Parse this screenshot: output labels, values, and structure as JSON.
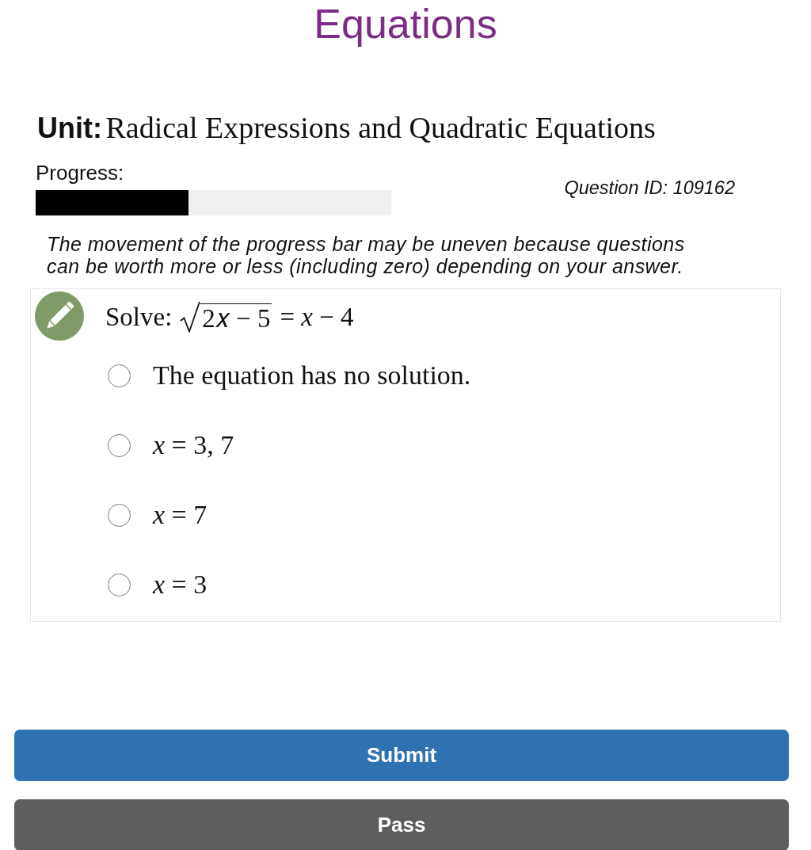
{
  "page_title": "Equations",
  "unit": {
    "label": "Unit:",
    "name": "Radical Expressions and Quadratic Equations"
  },
  "progress": {
    "label": "Progress:",
    "level": 0.43
  },
  "question_id": "Question ID: 109162",
  "note": "The movement of the progress bar may be uneven because questions can be worth more or less (including zero) depending on your answer.",
  "question": {
    "prompt": "Solve:",
    "radicand": "2𝑥 − 5",
    "right_side": "= *x* − 4",
    "options": [
      {
        "text": "The equation has no solution.",
        "selected": false
      },
      {
        "text": "*x* = 3, 7",
        "selected": false
      },
      {
        "text": "*x* = 7",
        "selected": false
      },
      {
        "text": "*x* = 3",
        "selected": false
      }
    ]
  },
  "buttons": [
    {
      "label": "Submit",
      "kind": "primary"
    },
    {
      "label": "Pass",
      "kind": "secondary"
    }
  ]
}
